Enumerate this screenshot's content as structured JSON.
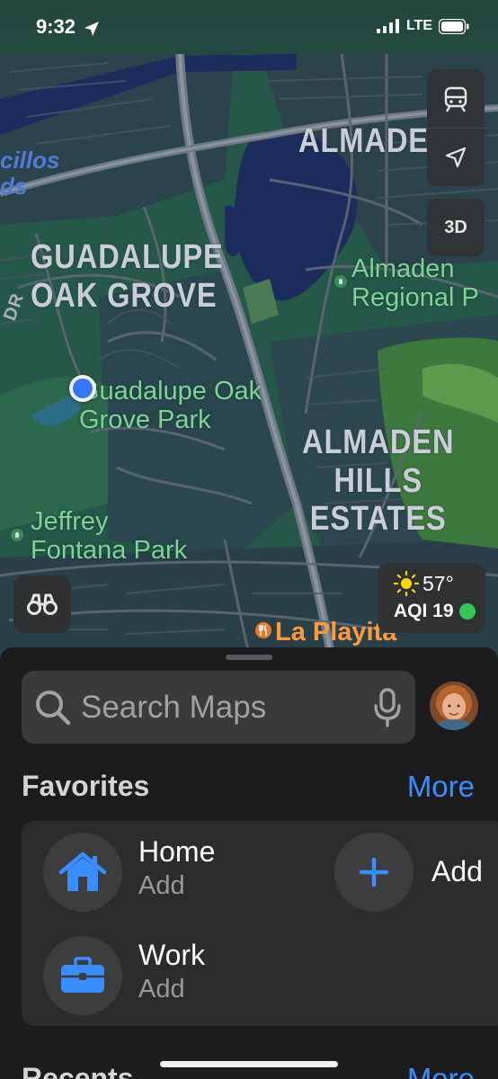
{
  "status_bar": {
    "time": "9:32",
    "network": "LTE",
    "icons": [
      "location-arrow-icon",
      "signal-bars-icon",
      "battery-icon"
    ]
  },
  "map": {
    "area_labels": [
      "GUADALUPE\nOAK GROVE",
      "ALMADEN",
      "ALMADEN\nHILLS\nESTATES"
    ],
    "park_labels": [
      "Guadalupe Oak\nGrove Park",
      "Jeffrey\nFontana Park",
      "Almaden\nRegional P"
    ],
    "water_label": "cillos\nds",
    "road_label": "DR",
    "poi_label": "La Playita",
    "controls": {
      "transit_icon": "tram-icon",
      "location_icon": "location-arrow-icon",
      "three_d_label": "3D",
      "look_around_icon": "binoculars-icon"
    },
    "weather": {
      "icon": "sun-icon",
      "temperature": "57°",
      "aqi_label": "AQI 19",
      "aqi_color": "#33c758"
    },
    "colors": {
      "user_location": "#3478f6",
      "park": "#7fd39a",
      "poi": "#ff9a3c",
      "water": "#1c2c5c"
    }
  },
  "sheet": {
    "search": {
      "placeholder": "Search Maps"
    },
    "favorites": {
      "title": "Favorites",
      "more_label": "More",
      "items": [
        {
          "name": "Home",
          "subtitle": "Add",
          "icon": "house-icon"
        },
        {
          "name": "Add",
          "icon": "plus-icon"
        },
        {
          "name": "Work",
          "subtitle": "Add",
          "icon": "briefcase-icon"
        }
      ]
    },
    "recents": {
      "title": "Recents",
      "more_label": "More"
    },
    "accent_color": "#3a8dff"
  }
}
